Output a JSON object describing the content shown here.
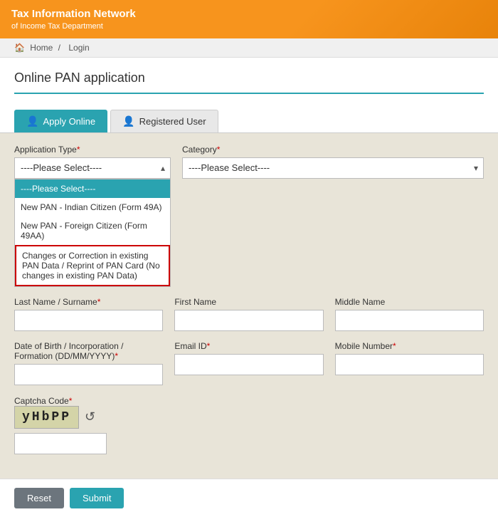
{
  "header": {
    "title_main": "Tax Information Network",
    "title_sub": "of Income Tax Department",
    "logo_icon": "building-icon"
  },
  "breadcrumb": {
    "home": "Home",
    "separator": "/",
    "current": "Login"
  },
  "page": {
    "title": "Online PAN application"
  },
  "tabs": [
    {
      "id": "apply-online",
      "label": "Apply Online",
      "active": true,
      "icon": "user-add-icon"
    },
    {
      "id": "registered-user",
      "label": "Registered User",
      "active": false,
      "icon": "user-icon"
    }
  ],
  "form": {
    "application_type_label": "Application Type",
    "application_type_req": "*",
    "application_type_placeholder": "----Please Select----",
    "category_label": "Category",
    "category_req": "*",
    "category_placeholder": "----Please Select----",
    "dropdown_items": [
      {
        "id": "please-select",
        "label": "----Please Select----",
        "selected": true
      },
      {
        "id": "new-pan-indian",
        "label": "New PAN - Indian Citizen (Form 49A)"
      },
      {
        "id": "new-pan-foreign",
        "label": "New PAN - Foreign Citizen (Form 49AA)"
      },
      {
        "id": "changes-correction",
        "label": "Changes or Correction in existing PAN Data / Reprint of PAN Card (No changes in existing PAN Data)",
        "highlighted": true
      }
    ],
    "last_name_label": "Last Name / Surname",
    "last_name_req": "*",
    "first_name_label": "First Name",
    "middle_name_label": "Middle Name",
    "dob_label": "Date of Birth / Incorporation / Formation (DD/MM/YYYY)",
    "dob_req": "*",
    "email_label": "Email ID",
    "email_req": "*",
    "mobile_label": "Mobile Number",
    "mobile_req": "*",
    "captcha_label": "Captcha Code",
    "captcha_req": "*",
    "captcha_value": "yHbPP",
    "captcha_refresh_icon": "refresh-icon"
  },
  "buttons": {
    "reset": "Reset",
    "submit": "Submit"
  }
}
